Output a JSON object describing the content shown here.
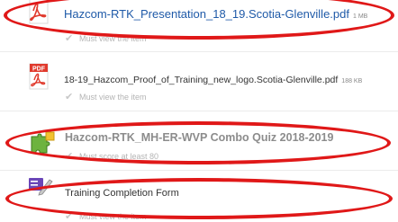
{
  "items": [
    {
      "name": "Hazcom-RTK_Presentation_18_19.Scotia-Glenville.pdf",
      "size": "1 MB",
      "requirement": "Must view the item",
      "icon": "pdf-icon"
    },
    {
      "name": "18-19_Hazcom_Proof_of_Training_new_logo.Scotia-Glenville.pdf",
      "size": "188 KB",
      "requirement": "Must view the item",
      "icon": "pdf-icon"
    },
    {
      "name": "Hazcom-RTK_MH-ER-WVP Combo Quiz 2018-2019",
      "requirement": "Must score at least 80",
      "icon": "quiz-puzzle-icon"
    },
    {
      "name": "Training Completion Form",
      "requirement": "Must view the item",
      "icon": "form-pencil-icon"
    }
  ],
  "colors": {
    "annotation_red": "#e01818",
    "pdf_red": "#e03a2d",
    "link_blue": "#1f5aa8",
    "muted_gray": "#b4b4b4"
  },
  "pdf_icon_label": "PDF"
}
